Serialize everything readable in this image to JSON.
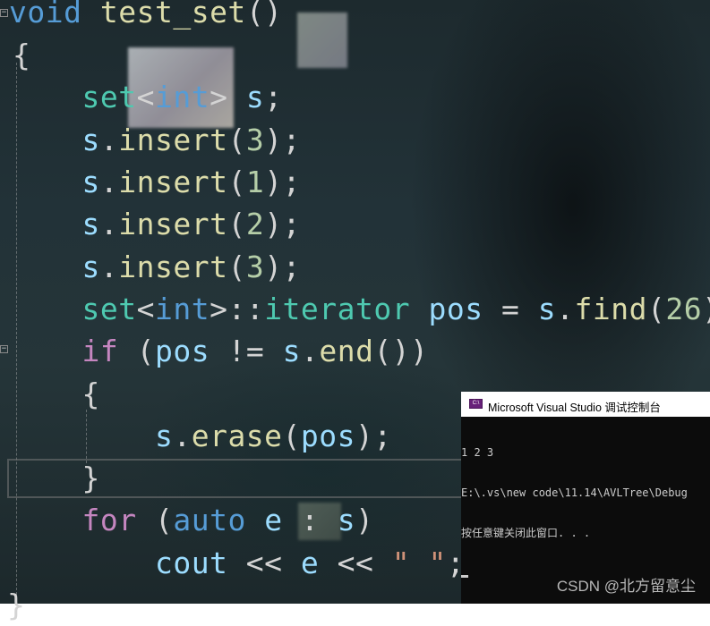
{
  "editor": {
    "lines": [
      [
        {
          "t": "void",
          "c": "kw"
        },
        {
          "t": " ",
          "c": "pl"
        },
        {
          "t": "test_set",
          "c": "fn"
        },
        {
          "t": "()",
          "c": "pl"
        }
      ],
      [
        {
          "t": "{",
          "c": "pl"
        }
      ],
      [
        {
          "t": "    ",
          "c": "pl"
        },
        {
          "t": "set",
          "c": "ty"
        },
        {
          "t": "<",
          "c": "pl"
        },
        {
          "t": "int",
          "c": "kw"
        },
        {
          "t": "> ",
          "c": "pl"
        },
        {
          "t": "s",
          "c": "id"
        },
        {
          "t": ";",
          "c": "pl"
        }
      ],
      [
        {
          "t": "    ",
          "c": "pl"
        },
        {
          "t": "s",
          "c": "id"
        },
        {
          "t": ".",
          "c": "pl"
        },
        {
          "t": "insert",
          "c": "fn"
        },
        {
          "t": "(",
          "c": "pl"
        },
        {
          "t": "3",
          "c": "nm"
        },
        {
          "t": ");",
          "c": "pl"
        }
      ],
      [
        {
          "t": "    ",
          "c": "pl"
        },
        {
          "t": "s",
          "c": "id"
        },
        {
          "t": ".",
          "c": "pl"
        },
        {
          "t": "insert",
          "c": "fn"
        },
        {
          "t": "(",
          "c": "pl"
        },
        {
          "t": "1",
          "c": "nm"
        },
        {
          "t": ");",
          "c": "pl"
        }
      ],
      [
        {
          "t": "    ",
          "c": "pl"
        },
        {
          "t": "s",
          "c": "id"
        },
        {
          "t": ".",
          "c": "pl"
        },
        {
          "t": "insert",
          "c": "fn"
        },
        {
          "t": "(",
          "c": "pl"
        },
        {
          "t": "2",
          "c": "nm"
        },
        {
          "t": ");",
          "c": "pl"
        }
      ],
      [
        {
          "t": "    ",
          "c": "pl"
        },
        {
          "t": "s",
          "c": "id"
        },
        {
          "t": ".",
          "c": "pl"
        },
        {
          "t": "insert",
          "c": "fn"
        },
        {
          "t": "(",
          "c": "pl"
        },
        {
          "t": "3",
          "c": "nm"
        },
        {
          "t": ");",
          "c": "pl"
        }
      ],
      [
        {
          "t": "    ",
          "c": "pl"
        },
        {
          "t": "set",
          "c": "ty"
        },
        {
          "t": "<",
          "c": "pl"
        },
        {
          "t": "int",
          "c": "kw"
        },
        {
          "t": ">::",
          "c": "pl"
        },
        {
          "t": "iterator",
          "c": "ty"
        },
        {
          "t": " ",
          "c": "pl"
        },
        {
          "t": "pos",
          "c": "id"
        },
        {
          "t": " = ",
          "c": "pl"
        },
        {
          "t": "s",
          "c": "id"
        },
        {
          "t": ".",
          "c": "pl"
        },
        {
          "t": "find",
          "c": "fn"
        },
        {
          "t": "(",
          "c": "pl"
        },
        {
          "t": "26",
          "c": "nm"
        },
        {
          "t": ");",
          "c": "pl"
        }
      ],
      [
        {
          "t": "    ",
          "c": "pl"
        },
        {
          "t": "if",
          "c": "ct"
        },
        {
          "t": " (",
          "c": "pl"
        },
        {
          "t": "pos",
          "c": "id"
        },
        {
          "t": " != ",
          "c": "pl"
        },
        {
          "t": "s",
          "c": "id"
        },
        {
          "t": ".",
          "c": "pl"
        },
        {
          "t": "end",
          "c": "fn"
        },
        {
          "t": "())",
          "c": "pl"
        }
      ],
      [
        {
          "t": "    {",
          "c": "pl"
        }
      ],
      [
        {
          "t": "        ",
          "c": "pl"
        },
        {
          "t": "s",
          "c": "id"
        },
        {
          "t": ".",
          "c": "pl"
        },
        {
          "t": "erase",
          "c": "fn"
        },
        {
          "t": "(",
          "c": "pl"
        },
        {
          "t": "pos",
          "c": "id"
        },
        {
          "t": ");",
          "c": "pl"
        }
      ],
      [
        {
          "t": "    }",
          "c": "pl"
        }
      ],
      [
        {
          "t": "    ",
          "c": "pl"
        },
        {
          "t": "for",
          "c": "ct"
        },
        {
          "t": " (",
          "c": "pl"
        },
        {
          "t": "auto",
          "c": "kw"
        },
        {
          "t": " ",
          "c": "pl"
        },
        {
          "t": "e",
          "c": "id"
        },
        {
          "t": " : ",
          "c": "pl"
        },
        {
          "t": "s",
          "c": "id"
        },
        {
          "t": ")",
          "c": "pl"
        }
      ],
      [
        {
          "t": "        ",
          "c": "pl"
        },
        {
          "t": "cout",
          "c": "id"
        },
        {
          "t": " << ",
          "c": "pl"
        },
        {
          "t": "e",
          "c": "id"
        },
        {
          "t": " << ",
          "c": "pl"
        },
        {
          "t": "\" \"",
          "c": "st"
        },
        {
          "t": ";",
          "c": "pl"
        }
      ],
      [
        {
          "t": "}",
          "c": "pl"
        }
      ]
    ],
    "fold_glyph": "−"
  },
  "console": {
    "icon_text": "C:\\",
    "title": "Microsoft Visual Studio 调试控制台",
    "output_lines": [
      "1 2 3",
      "E:\\.vs\\new code\\11.14\\AVLTree\\Debug",
      "按任意键关闭此窗口. . ."
    ]
  },
  "watermark": "CSDN @北方留意尘",
  "colors": {
    "keyword": "#569cd6",
    "type": "#4ec9b0",
    "function": "#dcdcaa",
    "identifier": "#9cdcfe",
    "control": "#c586c0",
    "number": "#b5cea8",
    "string": "#ce9178",
    "plain": "#d4d4d4",
    "console_bg": "#0c0c0c",
    "console_icon": "#68217a"
  }
}
